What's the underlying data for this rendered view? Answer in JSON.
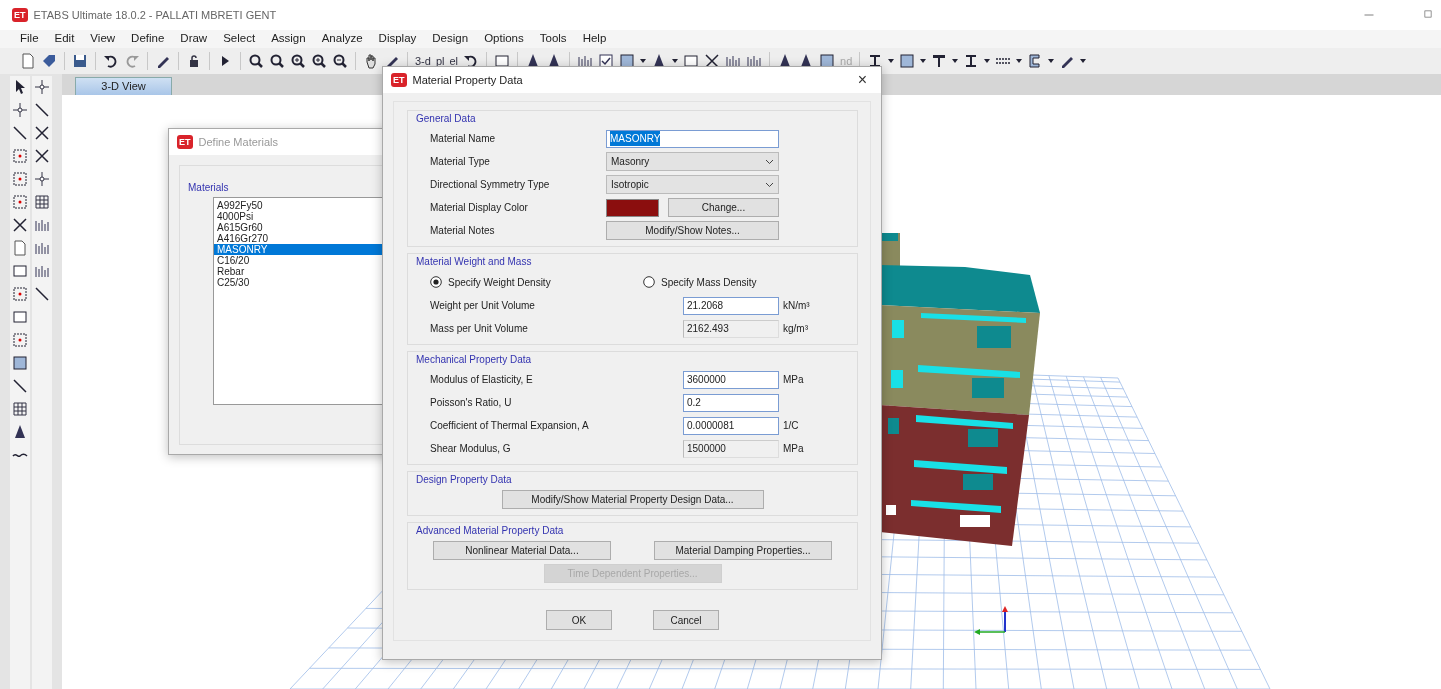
{
  "window": {
    "logo": "ET",
    "title": "ETABS Ultimate 18.0.2 - PALLATI MBRETI GENT"
  },
  "menu": [
    "File",
    "Edit",
    "View",
    "Define",
    "Draw",
    "Select",
    "Assign",
    "Analyze",
    "Display",
    "Design",
    "Options",
    "Tools",
    "Help"
  ],
  "toolbar_texts": [
    {
      "text": "3-d",
      "disabled": false
    },
    {
      "text": "pl",
      "disabled": false
    },
    {
      "text": "el",
      "disabled": false
    },
    {
      "text": "nd",
      "disabled": true
    }
  ],
  "view_tabs": [
    {
      "label": "3-D View",
      "selected": true
    }
  ],
  "define_materials": {
    "logo": "ET",
    "title": "Define Materials",
    "group": "Materials",
    "items": [
      {
        "name": "A992Fy50",
        "selected": false
      },
      {
        "name": "4000Psi",
        "selected": false
      },
      {
        "name": "A615Gr60",
        "selected": false
      },
      {
        "name": "A416Gr270",
        "selected": false
      },
      {
        "name": "MASONRY",
        "selected": true
      },
      {
        "name": "C16/20",
        "selected": false
      },
      {
        "name": "Rebar",
        "selected": false
      },
      {
        "name": "C25/30",
        "selected": false
      }
    ]
  },
  "material_dialog": {
    "logo": "ET",
    "title": "Material Property Data",
    "close": "×",
    "sections": [
      {
        "heading": "General Data",
        "rows": [
          {
            "kind": "text",
            "label": "Material Name",
            "value": "MASONRY"
          },
          {
            "kind": "select",
            "label": "Material Type",
            "value": "Masonry"
          },
          {
            "kind": "select",
            "label": "Directional Symmetry Type",
            "value": "Isotropic"
          },
          {
            "kind": "color",
            "label": "Material Display Color",
            "color": "#8b0e0e",
            "button": "Change..."
          },
          {
            "kind": "button",
            "label": "Material Notes",
            "button": "Modify/Show Notes..."
          }
        ]
      },
      {
        "heading": "Material Weight and Mass",
        "rows": [
          {
            "kind": "radios",
            "options": [
              {
                "label": "Specify Weight Density",
                "selected": true
              },
              {
                "label": "Specify Mass Density",
                "selected": false
              }
            ]
          },
          {
            "kind": "number",
            "label": "Weight per Unit Volume",
            "value": "21.2068",
            "unit": "kN/m³",
            "readonly": false
          },
          {
            "kind": "number",
            "label": "Mass per Unit Volume",
            "value": "2162.493",
            "unit": "kg/m³",
            "readonly": true
          }
        ]
      },
      {
        "heading": "Mechanical Property Data",
        "rows": [
          {
            "kind": "number",
            "label": "Modulus of Elasticity,  E",
            "value": "3600000",
            "unit": "MPa",
            "readonly": false
          },
          {
            "kind": "number",
            "label": "Poisson's Ratio,  U",
            "value": "0.2",
            "readonly": false
          },
          {
            "kind": "number",
            "label": "Coefficient of Thermal Expansion,  A",
            "value": "0.0000081",
            "unit": "1/C",
            "readonly": false
          },
          {
            "kind": "number",
            "label": "Shear Modulus,  G",
            "value": "1500000",
            "unit": "MPa",
            "readonly": true
          }
        ]
      },
      {
        "heading": "Design Property Data",
        "rows": [
          {
            "kind": "buttons",
            "buttons": [
              {
                "label": "Modify/Show Material Property Design Data...",
                "disabled": false
              }
            ]
          }
        ]
      },
      {
        "heading": "Advanced Material Property Data",
        "rows": [
          {
            "kind": "buttons",
            "buttons": [
              {
                "label": "Nonlinear Material Data...",
                "disabled": false
              },
              {
                "label": "Material Damping Properties...",
                "disabled": false
              }
            ]
          },
          {
            "kind": "buttons",
            "buttons": [
              {
                "label": "Time Dependent Properties...",
                "disabled": true
              }
            ]
          }
        ]
      }
    ],
    "footer": [
      "OK",
      "Cancel"
    ]
  }
}
